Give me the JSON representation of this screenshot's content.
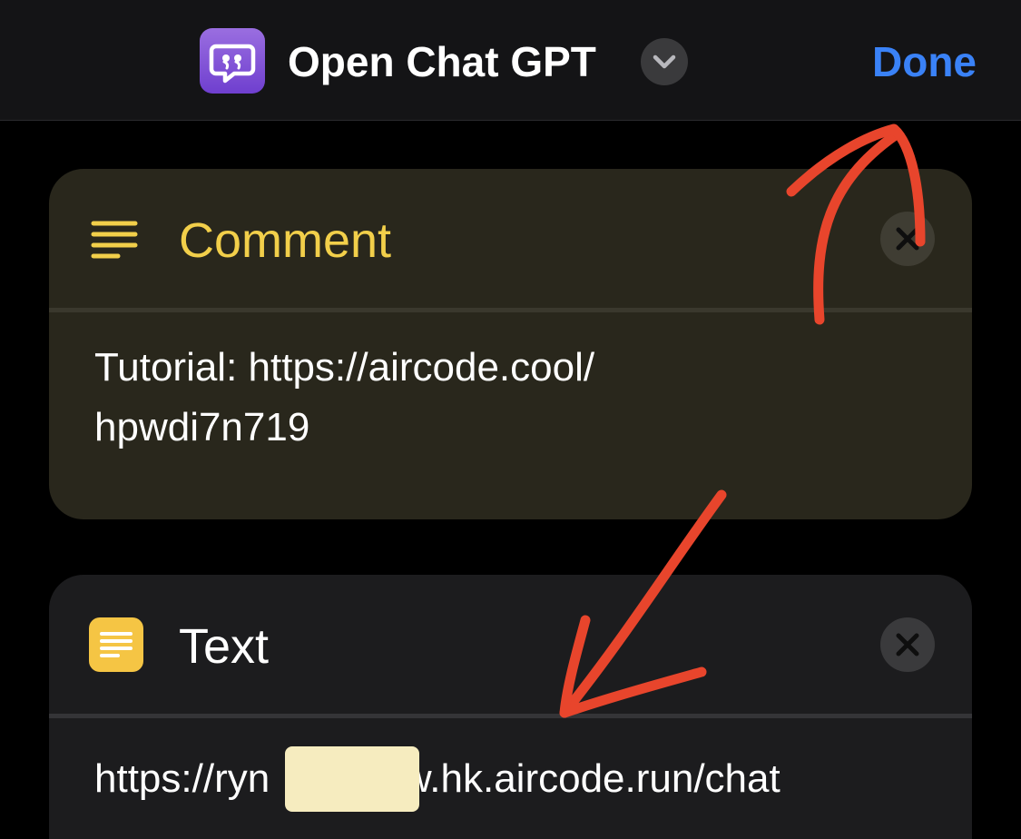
{
  "nav": {
    "title": "Open Chat GPT",
    "done_label": "Done",
    "app_icon": "quote-bubble-icon",
    "chevron_icon": "chevron-down-icon"
  },
  "comment_card": {
    "title": "Comment",
    "icon": "text-lines-icon",
    "body": "Tutorial: https://aircode.cool/\nhpwdi7n719",
    "remove_icon": "close-icon"
  },
  "text_card": {
    "title": "Text",
    "icon": "text-document-icon",
    "body": "https://ryn        qdw.hk.aircode.run/chat",
    "remove_icon": "close-icon"
  },
  "colors": {
    "background": "#000000",
    "nav_background": "#141416",
    "accent_blue": "#3a82f7",
    "comment_yellow": "#f2cf4a",
    "comment_card_bg": "#29271c",
    "text_card_bg": "#1c1c1e",
    "annotation_arrow": "#e8452c",
    "redaction": "#f6ecbf"
  }
}
